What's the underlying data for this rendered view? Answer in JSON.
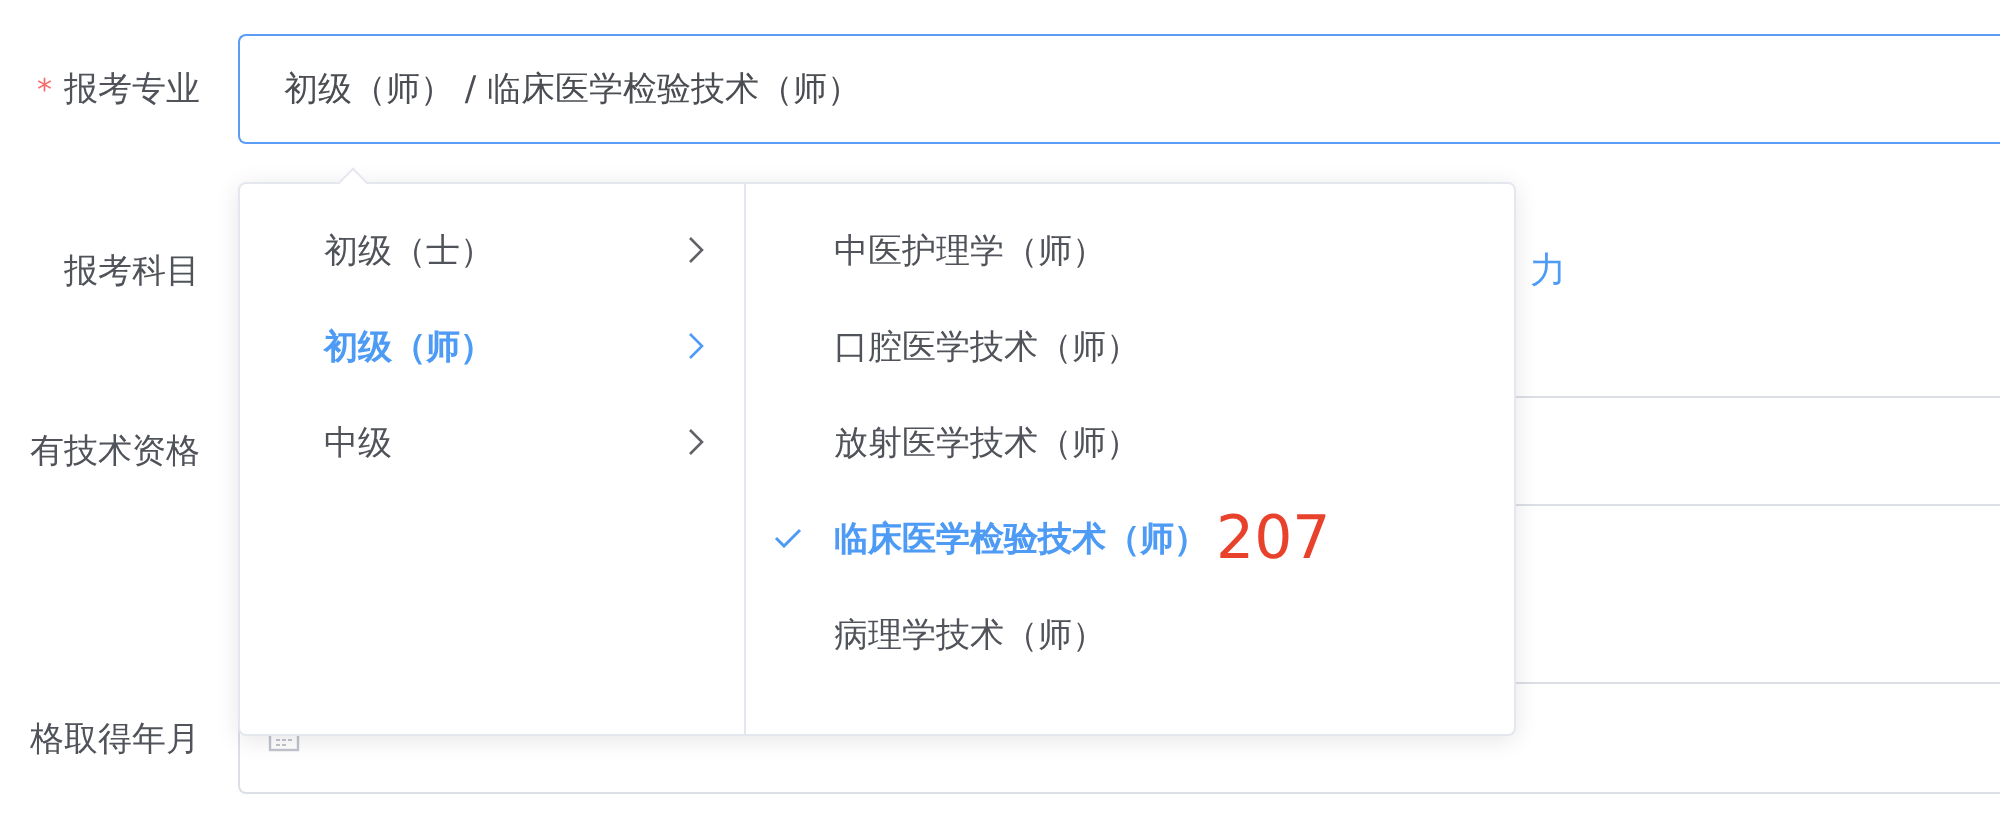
{
  "form": {
    "fields": [
      {
        "kind": "select",
        "required_mark": "*",
        "label": "报考专业",
        "value": "初级（师） / 临床医学检验技术（师）"
      },
      {
        "kind": "link",
        "label": "报考科目",
        "link": "力"
      },
      {
        "kind": "input",
        "label": "有技术资格"
      },
      {
        "kind": "textarea"
      },
      {
        "kind": "date",
        "label": "格取得年月"
      }
    ]
  },
  "cascader": {
    "columns": [
      {
        "kind": "parent",
        "items": [
          {
            "label": "初级（士）",
            "selected": false
          },
          {
            "label": "初级（师）",
            "selected": true
          },
          {
            "label": "中级",
            "selected": false
          }
        ]
      },
      {
        "kind": "leaf",
        "items": [
          {
            "label": "中医护理学（师）",
            "selected": false
          },
          {
            "label": "口腔医学技术（师）",
            "selected": false
          },
          {
            "label": "放射医学技术（师）",
            "selected": false
          },
          {
            "label": "临床医学检验技术（师）",
            "selected": true,
            "annotation": "207"
          },
          {
            "label": "病理学技术（师）",
            "selected": false
          }
        ]
      }
    ]
  }
}
